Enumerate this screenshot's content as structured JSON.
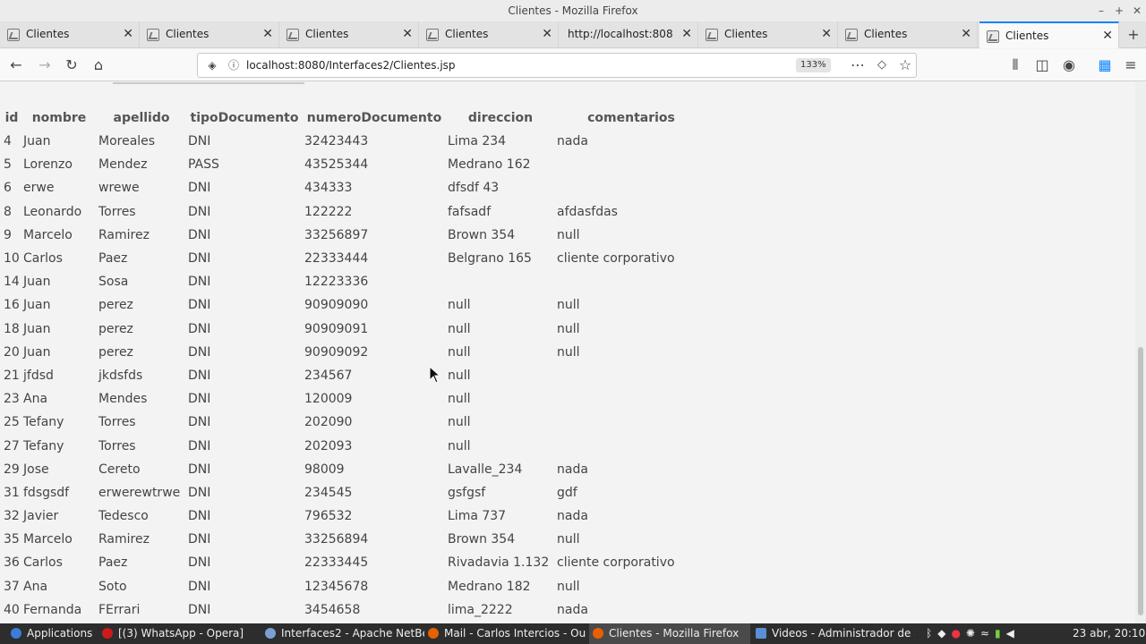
{
  "window": {
    "title": "Clientes - Mozilla Firefox"
  },
  "tabs": [
    {
      "label": "Clientes"
    },
    {
      "label": "Clientes"
    },
    {
      "label": "Clientes"
    },
    {
      "label": "Clientes"
    },
    {
      "label": "http://localhost:8080/I"
    },
    {
      "label": "Clientes"
    },
    {
      "label": "Clientes"
    },
    {
      "label": "Clientes"
    }
  ],
  "nav": {
    "url": "localhost:8080/Interfaces2/Clientes.jsp",
    "zoom": "133%"
  },
  "table": {
    "headers": [
      "id",
      "nombre",
      "apellido",
      "tipoDocumento",
      "numeroDocumento",
      "direccion",
      "comentarios"
    ],
    "rows": [
      [
        "4",
        "Juan",
        "Moreales",
        "DNI",
        "32423443",
        "Lima 234",
        "nada"
      ],
      [
        "5",
        "Lorenzo",
        "Mendez",
        "PASS",
        "43525344",
        "Medrano 162",
        ""
      ],
      [
        "6",
        "erwe",
        "wrewe",
        "DNI",
        "434333",
        "dfsdf 43",
        ""
      ],
      [
        "8",
        "Leonardo",
        "Torres",
        "DNI",
        "122222",
        "fafsadf",
        "afdasfdas"
      ],
      [
        "9",
        "Marcelo",
        "Ramirez",
        "DNI",
        "33256897",
        "Brown 354",
        "null"
      ],
      [
        "10",
        "Carlos",
        "Paez",
        "DNI",
        "22333444",
        "Belgrano 165",
        "cliente corporativo"
      ],
      [
        "14",
        "Juan",
        "Sosa",
        "DNI",
        "12223336",
        "",
        ""
      ],
      [
        "16",
        "Juan",
        "perez",
        "DNI",
        "90909090",
        "null",
        "null"
      ],
      [
        "18",
        "Juan",
        "perez",
        "DNI",
        "90909091",
        "null",
        "null"
      ],
      [
        "20",
        "Juan",
        "perez",
        "DNI",
        "90909092",
        "null",
        "null"
      ],
      [
        "21",
        "jfdsd",
        "jkdsfds",
        "DNI",
        "234567",
        "null",
        ""
      ],
      [
        "23",
        "Ana",
        "Mendes",
        "DNI",
        "120009",
        "null",
        ""
      ],
      [
        "25",
        "Tefany",
        "Torres",
        "DNI",
        "202090",
        "null",
        ""
      ],
      [
        "27",
        "Tefany",
        "Torres",
        "DNI",
        "202093",
        "null",
        ""
      ],
      [
        "29",
        "Jose",
        "Cereto",
        "DNI",
        "98009",
        "Lavalle_234",
        "nada"
      ],
      [
        "31",
        "fdsgsdf",
        "erwerewtrwe",
        "DNI",
        "234545",
        "gsfgsf",
        "gdf"
      ],
      [
        "32",
        "Javier",
        "Tedesco",
        "DNI",
        "796532",
        "Lima 737",
        "nada"
      ],
      [
        "35",
        "Marcelo",
        "Ramirez",
        "DNI",
        "33256894",
        "Brown 354",
        "null"
      ],
      [
        "36",
        "Carlos",
        "Paez",
        "DNI",
        "22333445",
        "Rivadavia 1.132",
        "cliente corporativo"
      ],
      [
        "37",
        "Ana",
        "Soto",
        "DNI",
        "12345678",
        "Medrano 182",
        "null"
      ],
      [
        "40",
        "Fernanda",
        "FErrari",
        "DNI",
        "3454658",
        "lima_2222",
        "nada"
      ]
    ]
  },
  "taskbar": {
    "items": [
      {
        "label": "Applications",
        "color": "#3b7dd8"
      },
      {
        "label": "[(3) WhatsApp - Opera]",
        "color": "#cc1b1b"
      },
      {
        "label": "Interfaces2 - Apache NetBe...",
        "color": "#7a9fd1"
      },
      {
        "label": "Mail - Carlos Intercios - Ou...",
        "color": "#e66000"
      },
      {
        "label": "Clientes - Mozilla Firefox",
        "color": "#e66000"
      },
      {
        "label": "Videos - Administrador de a...",
        "color": "#5a8fd6"
      }
    ],
    "clock": "23 abr, 20:10"
  }
}
